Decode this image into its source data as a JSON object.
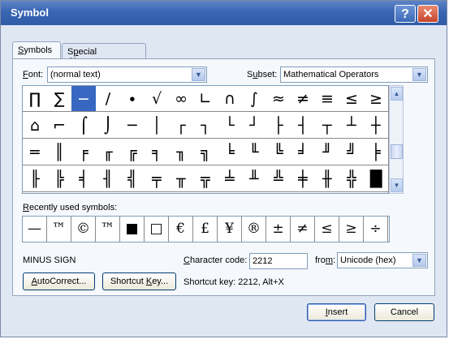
{
  "title": "Symbol",
  "titlebar": {
    "help_glyph": "?",
    "close_glyph": "✕"
  },
  "tabs": [
    {
      "u": "S",
      "rest": "ymbols"
    },
    {
      "pre": "S",
      "u": "p",
      "rest": "ecial Characters"
    }
  ],
  "font": {
    "u": "F",
    "rest": "ont:",
    "value": "(normal text)"
  },
  "subset": {
    "pre": "S",
    "u": "u",
    "rest": "bset:",
    "value": "Mathematical Operators"
  },
  "symbols": [
    [
      "∏",
      "∑",
      "−",
      "∕",
      "∙",
      "√",
      "∞",
      "∟",
      "∩",
      "∫",
      "≈",
      "≠",
      "≡",
      "≤",
      "≥"
    ],
    [
      "⌂",
      "⌐",
      "⌠",
      "⌡",
      "─",
      "│",
      "┌",
      "┐",
      "└",
      "┘",
      "├",
      "┤",
      "┬",
      "┴",
      "┼"
    ],
    [
      "═",
      "║",
      "╒",
      "╓",
      "╔",
      "╕",
      "╖",
      "╗",
      "╘",
      "╙",
      "╚",
      "╛",
      "╜",
      "╝",
      "╞"
    ],
    [
      "╟",
      "╠",
      "╡",
      "╢",
      "╣",
      "╤",
      "╥",
      "╦",
      "╧",
      "╨",
      "╩",
      "╪",
      "╫",
      "╬",
      "█"
    ]
  ],
  "selected_symbol": "−",
  "recent_label": {
    "u": "R",
    "rest": "ecently used symbols:"
  },
  "recent_symbols": [
    "—",
    "™",
    "©",
    "™",
    "■",
    "□",
    "€",
    "£",
    "¥",
    "®",
    "±",
    "≠",
    "≤",
    "≥",
    "÷"
  ],
  "char_name": "MINUS SIGN",
  "char_code": {
    "u": "C",
    "rest": "haracter code:",
    "value": "2212"
  },
  "from": {
    "pre": "fro",
    "u": "m",
    "rest": ":",
    "value": "Unicode (hex)"
  },
  "buttons": {
    "autocorrect": {
      "u": "A",
      "rest": "utoCorrect..."
    },
    "shortcut_key": {
      "pre": "Shortcut ",
      "u": "K",
      "rest": "ey..."
    },
    "insert": {
      "u": "I",
      "rest": "nsert"
    },
    "cancel": "Cancel"
  },
  "shortcut_text": "Shortcut key: 2212, Alt+X",
  "scroll": {
    "up_glyph": "▲",
    "down_glyph": "▼",
    "dropdown_glyph": "▼"
  }
}
